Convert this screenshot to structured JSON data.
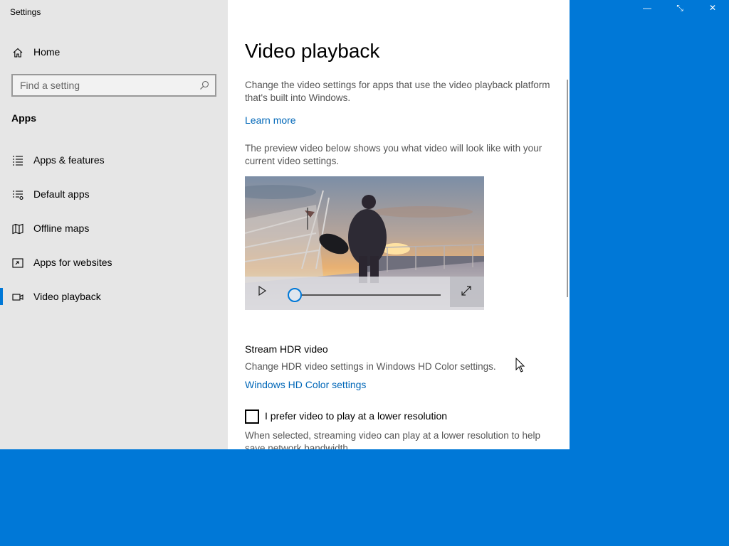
{
  "window": {
    "app_title": "Settings",
    "controls": {
      "minimize": "—",
      "restore": "⤡",
      "close": "✕"
    }
  },
  "sidebar": {
    "home_label": "Home",
    "search_placeholder": "Find a setting",
    "section": "Apps",
    "items": [
      {
        "label": "Apps & features",
        "icon": "apps-features-icon",
        "active": false
      },
      {
        "label": "Default apps",
        "icon": "default-apps-icon",
        "active": false
      },
      {
        "label": "Offline maps",
        "icon": "offline-maps-icon",
        "active": false
      },
      {
        "label": "Apps for websites",
        "icon": "apps-for-websites-icon",
        "active": false
      },
      {
        "label": "Video playback",
        "icon": "video-playback-icon",
        "active": true
      }
    ]
  },
  "main": {
    "title": "Video playback",
    "intro": "Change the video settings for apps that use the video playback platform that's built into Windows.",
    "learn_more": "Learn more",
    "preview_text": "The preview video below shows you what video will look like with your current video settings.",
    "hdr": {
      "heading": "Stream HDR video",
      "description": "Change HDR video settings in Windows HD Color settings.",
      "link": "Windows HD Color settings"
    },
    "lower_res": {
      "label": "I prefer video to play at a lower resolution",
      "description": "When selected, streaming video can play at a lower resolution to help save network bandwidth",
      "checked": false
    }
  },
  "video": {
    "progress": 0
  },
  "colors": {
    "accent": "#0078d7",
    "link": "#0067b8",
    "desktop": "#0078d7",
    "sidebar_bg": "#e6e6e6"
  }
}
